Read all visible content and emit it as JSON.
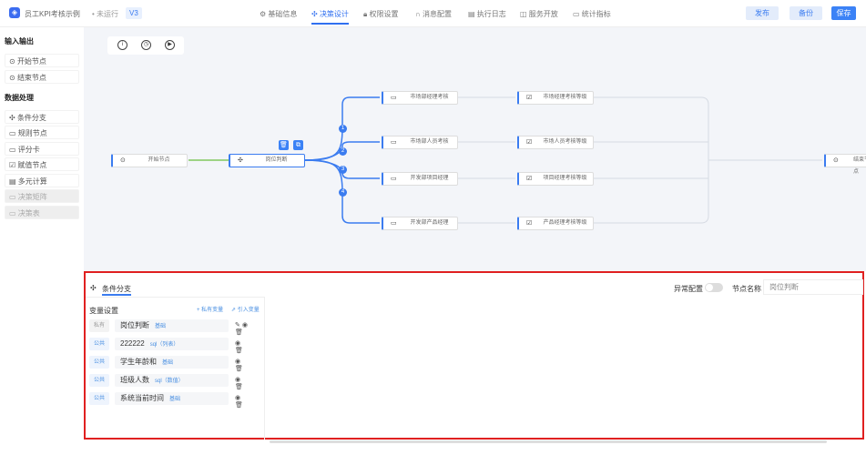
{
  "header": {
    "title": "员工KPI考核示例",
    "status": "未运行",
    "version": "V3",
    "tabs": [
      {
        "label": "基础信息",
        "icon": "gear-icon"
      },
      {
        "label": "决策设计",
        "icon": "move-icon"
      },
      {
        "label": "权限设置",
        "icon": "lock-icon"
      },
      {
        "label": "消息配置",
        "icon": "headset-icon"
      },
      {
        "label": "执行日志",
        "icon": "doc-icon"
      },
      {
        "label": "服务开放",
        "icon": "api-icon"
      },
      {
        "label": "统计指标",
        "icon": "chart-icon"
      }
    ],
    "active_tab": "决策设计",
    "buttons": {
      "publish": "发布",
      "backup": "备份",
      "save": "保存"
    }
  },
  "sidebar": {
    "groups": [
      {
        "title": "输入输出",
        "items": [
          "开始节点",
          "结束节点"
        ]
      },
      {
        "title": "数据处理",
        "items": [
          "条件分支",
          "规则节点",
          "评分卡",
          "赋值节点",
          "多元计算",
          "决策矩阵",
          "决策表"
        ]
      }
    ]
  },
  "canvas": {
    "start": "开始节点",
    "decision": "岗位判断",
    "end": "结束节点",
    "branches": [
      {
        "n": "1",
        "a": "市场部经理考核",
        "b": "市场经理考核等级"
      },
      {
        "n": "2",
        "a": "市场部人员考核",
        "b": "市场人员考核等级"
      },
      {
        "n": "3",
        "a": "开发部项目经理",
        "b": "项目经理考核等级"
      },
      {
        "n": "4",
        "a": "开发部产品经理",
        "b": "产品经理考核等级"
      }
    ]
  },
  "panel": {
    "tab": "条件分支",
    "exception_label": "异常配置",
    "exception_enabled": false,
    "node_name_label": "节点名称",
    "node_name": "岗位判断",
    "vars_title": "变量设置",
    "add_private": "+ 私有变量",
    "import_var": "引入变量",
    "vars": [
      {
        "scope": "私有",
        "name": "岗位判断",
        "type": "基础"
      },
      {
        "scope": "公共",
        "name": "222222",
        "type": "sql（列表）"
      },
      {
        "scope": "公共",
        "name": "学生年龄和",
        "type": "基础"
      },
      {
        "scope": "公共",
        "name": "班级人数",
        "type": "sql（数值）"
      },
      {
        "scope": "公共",
        "name": "系统当前时间",
        "type": "基础"
      }
    ]
  },
  "colors": {
    "accent": "#3b7cf0",
    "highlight": "#e02020",
    "edge_start": "#6abf40"
  }
}
